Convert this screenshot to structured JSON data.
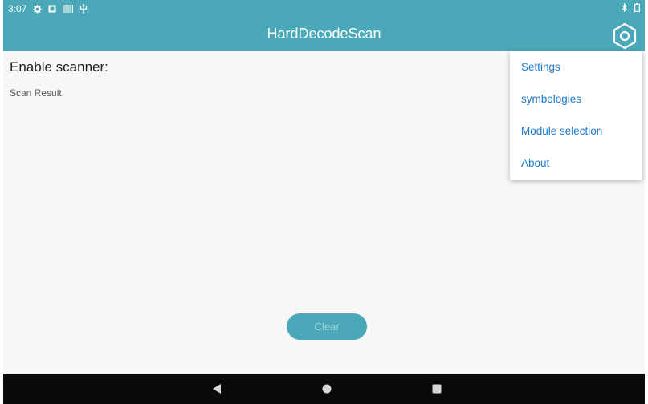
{
  "status_bar": {
    "time": "3:07",
    "left_icons": [
      "gear-icon",
      "image-notification-icon",
      "barcode-icon",
      "usb-icon"
    ],
    "right_icons": [
      "bluetooth-icon",
      "battery-icon"
    ]
  },
  "app_bar": {
    "title": "HardDecodeScan",
    "action_icon": "settings-gear-icon",
    "color": "#4aa8b8"
  },
  "main": {
    "enable_scanner_label": "Enable scanner:",
    "scan_result_label": "Scan Result:",
    "clear_button_label": "Clear"
  },
  "overflow_menu": {
    "items": [
      {
        "label": "Settings"
      },
      {
        "label": "symbologies"
      },
      {
        "label": "Module selection"
      },
      {
        "label": "About"
      }
    ],
    "text_color": "#1f78c8"
  },
  "nav_bar": {
    "buttons": [
      "back-icon",
      "home-icon",
      "recents-icon"
    ]
  }
}
